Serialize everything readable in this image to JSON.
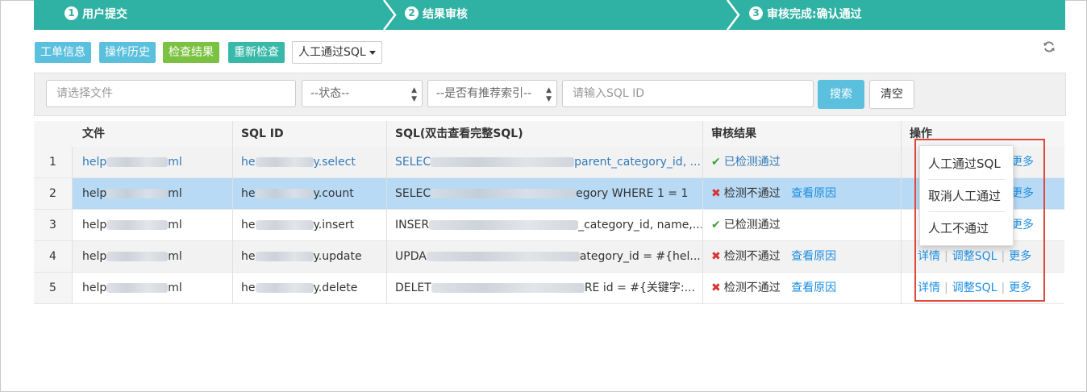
{
  "steps": [
    {
      "num": "1",
      "label": "用户提交"
    },
    {
      "num": "2",
      "label": "结果审核"
    },
    {
      "num": "3",
      "label": "审核完成:确认通过"
    }
  ],
  "toolbar": {
    "order_info": "工单信息",
    "history": "操作历史",
    "check_result": "检查结果",
    "recheck": "重新检查",
    "manual_pass": "人工通过SQL",
    "refresh_icon": "refresh-icon"
  },
  "filters": {
    "file_placeholder": "请选择文件",
    "status": "--状态--",
    "recommend_index": "--是否有推荐索引--",
    "sqlid_placeholder": "请输入SQL ID",
    "search": "搜索",
    "clear": "清空"
  },
  "table": {
    "columns": [
      "文件",
      "SQL ID",
      "SQL(双击查看完整SQL)",
      "审核结果",
      "操作"
    ],
    "rows": [
      {
        "idx": "1",
        "file_a": "help",
        "file_b": "ml",
        "sqlid_a": "he",
        "sqlid_b": "y.select",
        "sql_a": "SELEC",
        "sql_b": "parent_category_id, ...",
        "result": "已检测通过",
        "passed": true,
        "reason": ""
      },
      {
        "idx": "2",
        "file_a": "help",
        "file_b": "ml",
        "sqlid_a": "he",
        "sqlid_b": "y.count",
        "sql_a": "SELEC",
        "sql_b": "egory WHERE 1 = 1",
        "result": "检测不通过",
        "passed": false,
        "reason": "查看原因"
      },
      {
        "idx": "3",
        "file_a": "help",
        "file_b": "ml",
        "sqlid_a": "he",
        "sqlid_b": "y.insert",
        "sql_a": "INSER",
        "sql_b": "_category_id, name,...",
        "result": "已检测通过",
        "passed": true,
        "reason": ""
      },
      {
        "idx": "4",
        "file_a": "help",
        "file_b": "ml",
        "sqlid_a": "he",
        "sqlid_b": "y.update",
        "sql_a": "UPDA",
        "sql_b": "ategory_id = #{hel...",
        "result": "检测不通过",
        "passed": false,
        "reason": "查看原因"
      },
      {
        "idx": "5",
        "file_a": "help",
        "file_b": "ml",
        "sqlid_a": "he",
        "sqlid_b": "y.delete",
        "sql_a": "DELET",
        "sql_b": "RE id = #{关键字:...",
        "result": "检测不通过",
        "passed": false,
        "reason": "查看原因"
      }
    ],
    "ops": {
      "detail": "详情",
      "adjust": "调整SQL",
      "more": "更多",
      "sep": "|"
    }
  },
  "menu": {
    "items": [
      "人工通过SQL",
      "取消人工通过",
      "人工不通过"
    ]
  },
  "colors": {
    "steps_bg": "#2fb1a3",
    "highlight_border": "#e0473c",
    "selected_row": "#b8daf5"
  }
}
